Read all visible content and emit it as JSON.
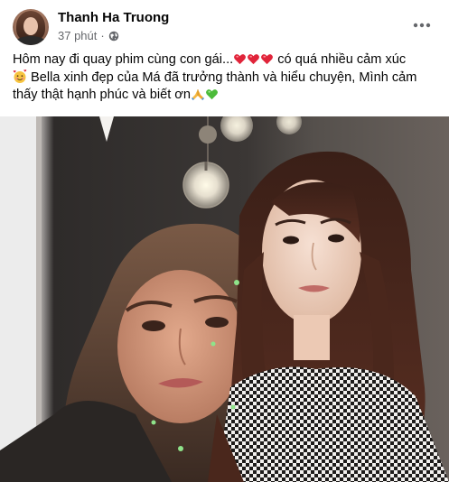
{
  "post": {
    "author": "Thanh Ha Truong",
    "time": "37 phút",
    "separator": "·",
    "privacy_icon": "globe-icon",
    "more_icon": "more-horizontal-icon",
    "caption": {
      "line1_text": "Hôm nay đi quay phim cùng con gái...",
      "line1_suffix": " có quá nhiều cảm xúc",
      "line2_text": " Bella xinh đẹp của Má đã trưởng thành và hiểu chuyện, Mình cảm",
      "line3_text": "thấy thật hạnh phúc và biết ơn",
      "emojis": [
        "heart-icon",
        "heart-icon",
        "heart-icon",
        "smiling-face-with-hearts-icon",
        "folded-hands-icon",
        "green-heart-icon"
      ]
    },
    "photo_description_icon": "photo-mother-daughter"
  },
  "colors": {
    "text": "#050505",
    "secondary": "#65676b",
    "heart_red": "#e0243a",
    "green_heart": "#4cbb3a"
  }
}
